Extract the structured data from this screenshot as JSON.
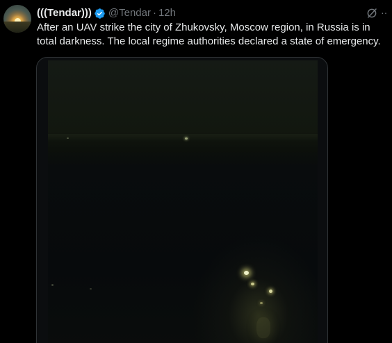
{
  "tweet": {
    "display_name": "(((Tendar)))",
    "handle": "@Tendar",
    "separator": "·",
    "time": "12h",
    "text": "After an UAV strike the city of Zhukovsky, Moscow region, in Russia is in total darkness. The local regime authorities declared a state of emergency.",
    "more_label": "··",
    "verified_color": "#1d9bf0"
  },
  "icons": {
    "verified": "verified-badge-icon",
    "grok": "grok-icon",
    "more": "more-options-icon"
  }
}
